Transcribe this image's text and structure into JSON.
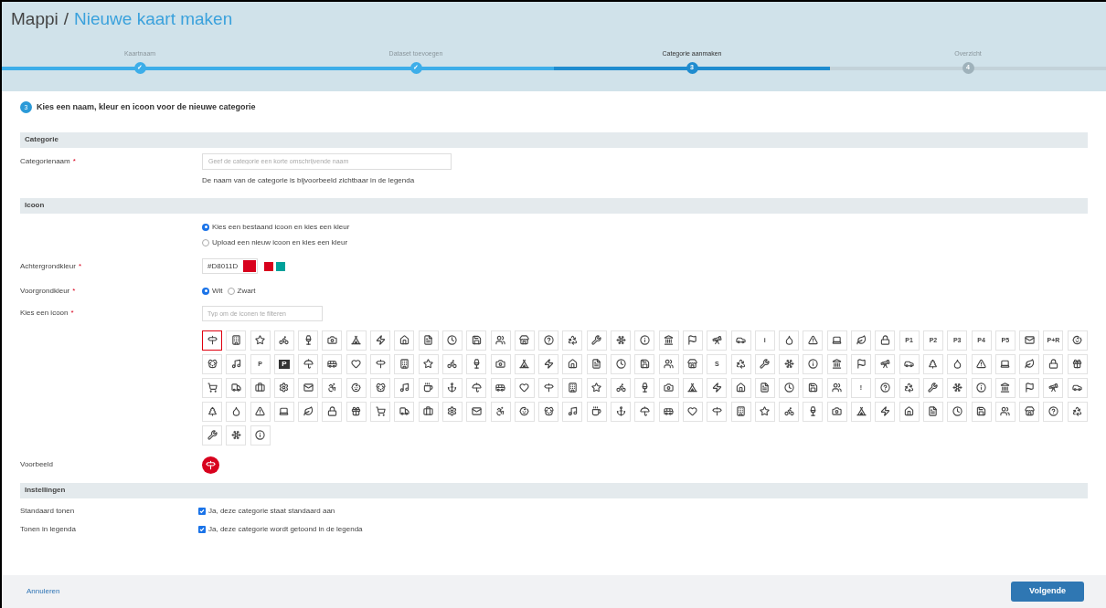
{
  "breadcrumb": {
    "root": "Mappi",
    "separator": "/",
    "current": "Nieuwe kaart maken"
  },
  "steps": [
    {
      "label": "Kaartnaam",
      "completed": true,
      "selected": false,
      "marker": "✓"
    },
    {
      "label": "Dataset toevoegen",
      "completed": true,
      "selected": false,
      "marker": "✓"
    },
    {
      "label": "Categorie aanmaken",
      "completed": false,
      "selected": true,
      "marker": "3"
    },
    {
      "label": "Overzicht",
      "completed": false,
      "selected": false,
      "marker": "4"
    }
  ],
  "step_heading": {
    "number": "3",
    "text": "Kies een naam, kleur en icoon voor de nieuwe categorie"
  },
  "sections": {
    "category": "Categorie",
    "icon": "Icoon",
    "settings": "Instellingen"
  },
  "name_field": {
    "label": "Categorienaam",
    "required": "*",
    "placeholder": "Geef de categorie een korte omschrijvende naam",
    "hint": "De naam van de categorie is bijvoorbeeld zichtbaar in de legenda"
  },
  "icon_source": [
    {
      "label": "Kies een bestaand icoon en kies een kleur",
      "selected": true
    },
    {
      "label": "Upload een nieuw icoon en kies een kleur",
      "selected": false
    }
  ],
  "background": {
    "label": "Achtergrondkleur",
    "required": "*",
    "value": "#D8011D",
    "color": "#d8011d",
    "swatches": [
      {
        "color": "#d8011d"
      },
      {
        "color": "#00a19a"
      }
    ]
  },
  "foreground": {
    "label": "Voorgrondkleur",
    "required": "*",
    "options": [
      {
        "label": "Wit",
        "selected": true
      },
      {
        "label": "Zwart",
        "selected": false
      }
    ]
  },
  "icon_filter": {
    "label": "Kies een icoon",
    "required": "*",
    "placeholder": "Typ om de iconen te filteren"
  },
  "icons": [
    {
      "kind": "glyph",
      "selected": true
    },
    {
      "kind": "glyph",
      "selected": false
    },
    {
      "kind": "glyph",
      "selected": false
    },
    {
      "kind": "glyph",
      "selected": false
    },
    {
      "kind": "glyph",
      "selected": false
    },
    {
      "kind": "glyph",
      "selected": false
    },
    {
      "kind": "glyph",
      "selected": false
    },
    {
      "kind": "glyph",
      "selected": false
    },
    {
      "kind": "glyph",
      "selected": false
    },
    {
      "kind": "glyph",
      "selected": false
    },
    {
      "kind": "glyph",
      "selected": false
    },
    {
      "kind": "glyph",
      "selected": false
    },
    {
      "kind": "glyph",
      "selected": false
    },
    {
      "kind": "glyph",
      "selected": false
    },
    {
      "kind": "glyph",
      "selected": false
    },
    {
      "kind": "glyph",
      "selected": false
    },
    {
      "kind": "glyph",
      "selected": false
    },
    {
      "kind": "glyph",
      "selected": false
    },
    {
      "kind": "glyph",
      "selected": false
    },
    {
      "kind": "glyph",
      "selected": false
    },
    {
      "kind": "glyph",
      "selected": false
    },
    {
      "kind": "glyph",
      "selected": false
    },
    {
      "kind": "glyph",
      "selected": false
    },
    {
      "kind": "text",
      "label": "i",
      "selected": false
    },
    {
      "kind": "glyph",
      "selected": false
    },
    {
      "kind": "glyph",
      "selected": false
    },
    {
      "kind": "glyph",
      "selected": false
    },
    {
      "kind": "glyph",
      "selected": false
    },
    {
      "kind": "glyph",
      "selected": false
    },
    {
      "kind": "text",
      "label": "P1",
      "selected": false
    },
    {
      "kind": "text",
      "label": "P2",
      "selected": false
    },
    {
      "kind": "text",
      "label": "P3",
      "selected": false
    },
    {
      "kind": "text",
      "label": "P4",
      "selected": false
    },
    {
      "kind": "text",
      "label": "P5",
      "selected": false
    },
    {
      "kind": "glyph",
      "selected": false
    },
    {
      "kind": "text",
      "label": "P+R",
      "selected": false
    },
    {
      "kind": "glyph",
      "selected": false
    },
    {
      "kind": "glyph",
      "selected": false
    },
    {
      "kind": "glyph",
      "selected": false
    },
    {
      "kind": "text",
      "label": "P",
      "selected": false
    },
    {
      "kind": "text-dark",
      "label": "P",
      "selected": false
    },
    {
      "kind": "glyph",
      "selected": false
    },
    {
      "kind": "glyph",
      "selected": false
    },
    {
      "kind": "glyph",
      "selected": false
    },
    {
      "kind": "glyph",
      "selected": false
    },
    {
      "kind": "glyph",
      "selected": false
    },
    {
      "kind": "glyph",
      "selected": false
    },
    {
      "kind": "glyph",
      "selected": false
    },
    {
      "kind": "glyph",
      "selected": false
    },
    {
      "kind": "glyph",
      "selected": false
    },
    {
      "kind": "glyph",
      "selected": false
    },
    {
      "kind": "glyph",
      "selected": false
    },
    {
      "kind": "glyph",
      "selected": false
    },
    {
      "kind": "glyph",
      "selected": false
    },
    {
      "kind": "glyph",
      "selected": false
    },
    {
      "kind": "glyph",
      "selected": false
    },
    {
      "kind": "glyph",
      "selected": false
    },
    {
      "kind": "glyph",
      "selected": false
    },
    {
      "kind": "text",
      "label": "S",
      "selected": false
    },
    {
      "kind": "glyph",
      "selected": false
    },
    {
      "kind": "glyph",
      "selected": false
    },
    {
      "kind": "glyph",
      "selected": false
    },
    {
      "kind": "glyph",
      "selected": false
    },
    {
      "kind": "glyph",
      "selected": false
    },
    {
      "kind": "glyph",
      "selected": false
    },
    {
      "kind": "glyph",
      "selected": false
    },
    {
      "kind": "glyph",
      "selected": false
    },
    {
      "kind": "glyph",
      "selected": false
    },
    {
      "kind": "glyph",
      "selected": false
    },
    {
      "kind": "glyph",
      "selected": false
    },
    {
      "kind": "glyph",
      "selected": false
    },
    {
      "kind": "glyph",
      "selected": false
    },
    {
      "kind": "glyph",
      "selected": false
    },
    {
      "kind": "glyph",
      "selected": false
    },
    {
      "kind": "glyph",
      "selected": false
    },
    {
      "kind": "glyph",
      "selected": false
    },
    {
      "kind": "glyph",
      "selected": false
    },
    {
      "kind": "glyph",
      "selected": false
    },
    {
      "kind": "glyph",
      "selected": false
    },
    {
      "kind": "glyph",
      "selected": false
    },
    {
      "kind": "glyph",
      "selected": false
    },
    {
      "kind": "glyph",
      "selected": false
    },
    {
      "kind": "glyph",
      "selected": false
    },
    {
      "kind": "glyph",
      "selected": false
    },
    {
      "kind": "glyph",
      "selected": false
    },
    {
      "kind": "glyph",
      "selected": false
    },
    {
      "kind": "glyph",
      "selected": false
    },
    {
      "kind": "glyph",
      "selected": false
    },
    {
      "kind": "glyph",
      "selected": false
    },
    {
      "kind": "glyph",
      "selected": false
    },
    {
      "kind": "glyph",
      "selected": false
    },
    {
      "kind": "glyph",
      "selected": false
    },
    {
      "kind": "glyph",
      "selected": false
    },
    {
      "kind": "glyph",
      "selected": false
    },
    {
      "kind": "glyph",
      "selected": false
    },
    {
      "kind": "glyph",
      "selected": false
    },
    {
      "kind": "glyph",
      "selected": false
    },
    {
      "kind": "glyph",
      "selected": false
    },
    {
      "kind": "glyph",
      "selected": false
    },
    {
      "kind": "glyph",
      "selected": false
    },
    {
      "kind": "glyph",
      "selected": false
    },
    {
      "kind": "text",
      "label": "!",
      "selected": false
    },
    {
      "kind": "glyph",
      "selected": false
    },
    {
      "kind": "glyph",
      "selected": false
    },
    {
      "kind": "glyph",
      "selected": false
    },
    {
      "kind": "glyph",
      "selected": false
    },
    {
      "kind": "glyph",
      "selected": false
    },
    {
      "kind": "glyph",
      "selected": false
    },
    {
      "kind": "glyph",
      "selected": false
    },
    {
      "kind": "glyph",
      "selected": false
    },
    {
      "kind": "glyph",
      "selected": false
    },
    {
      "kind": "glyph",
      "selected": false
    },
    {
      "kind": "glyph",
      "selected": false
    },
    {
      "kind": "glyph",
      "selected": false
    },
    {
      "kind": "glyph",
      "selected": false
    },
    {
      "kind": "glyph",
      "selected": false
    },
    {
      "kind": "glyph",
      "selected": false
    },
    {
      "kind": "glyph",
      "selected": false
    },
    {
      "kind": "glyph",
      "selected": false
    },
    {
      "kind": "glyph",
      "selected": false
    },
    {
      "kind": "glyph",
      "selected": false
    },
    {
      "kind": "glyph",
      "selected": false
    },
    {
      "kind": "glyph",
      "selected": false
    },
    {
      "kind": "glyph",
      "selected": false
    },
    {
      "kind": "glyph",
      "selected": false
    },
    {
      "kind": "glyph",
      "selected": false
    },
    {
      "kind": "glyph",
      "selected": false
    },
    {
      "kind": "glyph",
      "selected": false
    },
    {
      "kind": "glyph",
      "selected": false
    },
    {
      "kind": "glyph",
      "selected": false
    },
    {
      "kind": "glyph",
      "selected": false
    },
    {
      "kind": "glyph",
      "selected": false
    },
    {
      "kind": "glyph",
      "selected": false
    },
    {
      "kind": "glyph",
      "selected": false
    },
    {
      "kind": "glyph",
      "selected": false
    },
    {
      "kind": "glyph",
      "selected": false
    },
    {
      "kind": "glyph",
      "selected": false
    },
    {
      "kind": "glyph",
      "selected": false
    },
    {
      "kind": "glyph",
      "selected": false
    },
    {
      "kind": "glyph",
      "selected": false
    },
    {
      "kind": "glyph",
      "selected": false
    },
    {
      "kind": "glyph",
      "selected": false
    },
    {
      "kind": "glyph",
      "selected": false
    },
    {
      "kind": "glyph",
      "selected": false
    },
    {
      "kind": "glyph",
      "selected": false
    },
    {
      "kind": "glyph",
      "selected": false
    },
    {
      "kind": "glyph",
      "selected": false
    },
    {
      "kind": "glyph",
      "selected": false
    },
    {
      "kind": "glyph",
      "selected": false
    },
    {
      "kind": "glyph",
      "selected": false
    },
    {
      "kind": "glyph",
      "selected": false
    }
  ],
  "preview": {
    "label": "Voorbeeld"
  },
  "settings": [
    {
      "label": "Standaard tonen",
      "text": "Ja, deze categorie staat standaard aan",
      "checked": true
    },
    {
      "label": "Tonen in legenda",
      "text": "Ja, deze categorie wordt getoond in de legenda",
      "checked": true
    }
  ],
  "footer": {
    "cancel": "Annuleren",
    "next": "Volgende"
  }
}
